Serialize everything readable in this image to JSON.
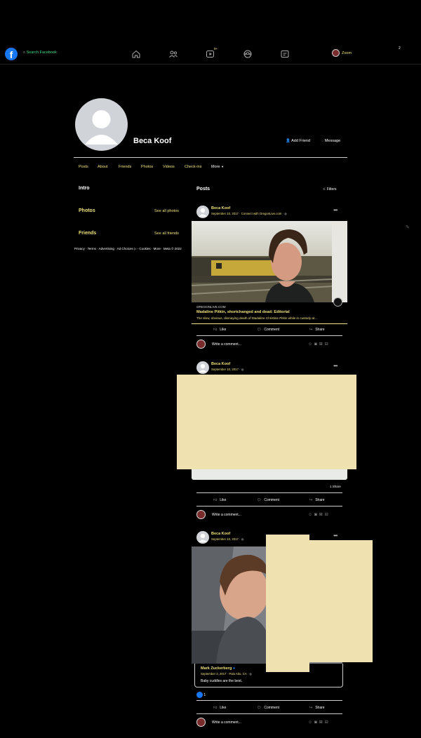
{
  "nav": {
    "search_placeholder": "Search Facebook",
    "video_badge": "9+",
    "user_label": "Zoom",
    "notif_count": "2"
  },
  "profile": {
    "name": "Beca Koof",
    "add_friend": "Add Friend",
    "message": "Message"
  },
  "tabs": [
    "Posts",
    "About",
    "Friends",
    "Photos",
    "Videos",
    "Check-ins",
    "More"
  ],
  "left": {
    "intro": "Intro",
    "photos": "Photos",
    "see_all_photos": "See all photos",
    "friends": "Friends",
    "see_all_friends": "See all friends",
    "footer": "Privacy · Terms · Advertising · Ad Choices ▷ · Cookies · More · Meta © 2022"
  },
  "posts_header": {
    "title": "Posts",
    "filters": "Filters"
  },
  "actions": {
    "like": "Like",
    "comment": "Comment",
    "share": "Share",
    "write_comment": "Write a comment..."
  },
  "post1": {
    "author": "Beca Koof",
    "meta": "September 10, 2017 · Connect with OregonLive.com · ",
    "link_domain": "OREGONLIVE.COM",
    "link_title": "Madaline Pitkin, shortchanged and dead: Editorial",
    "link_desc": "The slow, obvious, dismaying death of Madaline Christine Pitkin while in custody at..."
  },
  "post2": {
    "author": "Beca Koof",
    "meta": "September 10, 2017 · ",
    "shares": "1 Share"
  },
  "post3": {
    "author": "Beca Koof",
    "meta": "September 10, 2017 · ",
    "shared_author": "Mark Zuckerberg",
    "shared_meta": "September 3, 2017 · Palo Alto, CA · ",
    "shared_text": "Baby cuddles are the best.",
    "reactions": "1"
  }
}
